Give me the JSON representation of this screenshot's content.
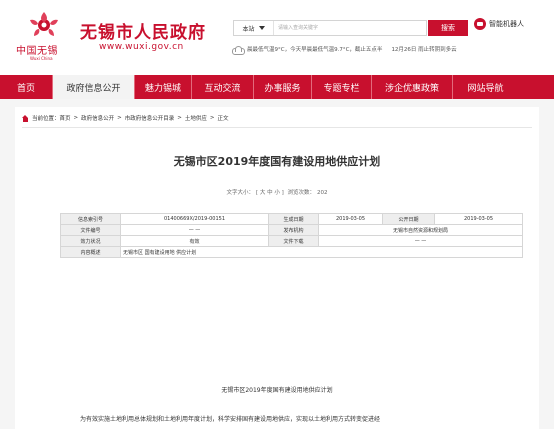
{
  "header": {
    "site_title": "无锡市人民政府",
    "site_url": "www.wuxi.gov.cn",
    "logo_text": "中国无锡",
    "logo_text_en": "Wuxi China"
  },
  "search": {
    "scope": "本站",
    "placeholder": "请输入查询关键字",
    "button_label": "搜索"
  },
  "robot": {
    "label": "智能机器人"
  },
  "weather": {
    "text": "晨最低气温9°C，今天早晨最低气温9.7°C，截止五点半",
    "date": "12月26日 雨止转阴到多云"
  },
  "nav": {
    "items": [
      {
        "label": "首页"
      },
      {
        "label": "政府信息公开"
      },
      {
        "label": "魅力锡城"
      },
      {
        "label": "互动交流"
      },
      {
        "label": "办事服务"
      },
      {
        "label": "专题专栏"
      },
      {
        "label": "涉企优惠政策"
      },
      {
        "label": "网站导航"
      }
    ]
  },
  "breadcrumb": {
    "prefix": "当前位置：",
    "items": [
      "首页",
      "政府信息公开",
      "市政府信息公开目录",
      "土地供应",
      "正文"
    ],
    "separator": ">"
  },
  "article": {
    "title": "无锡市区2019年度国有建设用地供应计划",
    "font_size_label": "文字大小：",
    "font_size_options": "[ 大  中  小 ]",
    "views_label": "浏览次数：",
    "views": "202"
  },
  "info_table": {
    "index_label": "信息索引号",
    "index_value": "01400669X/2019-00151",
    "created_label": "生成日期",
    "created_value": "2019-03-05",
    "published_label": "公开日期",
    "published_value": "2019-03-05",
    "doc_no_label": "文件编号",
    "doc_no_value": "— —",
    "issuer_label": "发布机构",
    "issuer_value": "无锡市自然资源和规划局",
    "validity_label": "效力状况",
    "validity_value": "有效",
    "download_label": "文件下载",
    "download_value": "— —",
    "summary_label": "内容概述",
    "summary_value": "无锡市区 国有建设用地 供应计划"
  },
  "body": {
    "heading": "无锡市区2019年度国有建设用地供应计划",
    "paragraph": "为有效实施土地利用总体规划和土地利用年度计划，科学安排国有建设用地供应，实现以土地利用方式转变促进经"
  },
  "colors": {
    "brand_red": "#c8102e",
    "nav_active_bg": "#f3f3f3",
    "table_label_bg": "#eeeeee"
  }
}
